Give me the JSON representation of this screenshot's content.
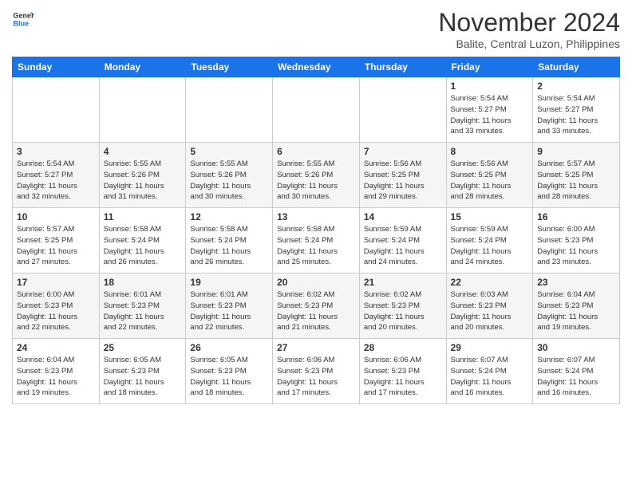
{
  "header": {
    "logo_line1": "General",
    "logo_line2": "Blue",
    "month": "November 2024",
    "location": "Balite, Central Luzon, Philippines"
  },
  "days_of_week": [
    "Sunday",
    "Monday",
    "Tuesday",
    "Wednesday",
    "Thursday",
    "Friday",
    "Saturday"
  ],
  "weeks": [
    [
      {
        "day": "",
        "info": ""
      },
      {
        "day": "",
        "info": ""
      },
      {
        "day": "",
        "info": ""
      },
      {
        "day": "",
        "info": ""
      },
      {
        "day": "",
        "info": ""
      },
      {
        "day": "1",
        "info": "Sunrise: 5:54 AM\nSunset: 5:27 PM\nDaylight: 11 hours\nand 33 minutes."
      },
      {
        "day": "2",
        "info": "Sunrise: 5:54 AM\nSunset: 5:27 PM\nDaylight: 11 hours\nand 33 minutes."
      }
    ],
    [
      {
        "day": "3",
        "info": "Sunrise: 5:54 AM\nSunset: 5:27 PM\nDaylight: 11 hours\nand 32 minutes."
      },
      {
        "day": "4",
        "info": "Sunrise: 5:55 AM\nSunset: 5:26 PM\nDaylight: 11 hours\nand 31 minutes."
      },
      {
        "day": "5",
        "info": "Sunrise: 5:55 AM\nSunset: 5:26 PM\nDaylight: 11 hours\nand 30 minutes."
      },
      {
        "day": "6",
        "info": "Sunrise: 5:55 AM\nSunset: 5:26 PM\nDaylight: 11 hours\nand 30 minutes."
      },
      {
        "day": "7",
        "info": "Sunrise: 5:56 AM\nSunset: 5:25 PM\nDaylight: 11 hours\nand 29 minutes."
      },
      {
        "day": "8",
        "info": "Sunrise: 5:56 AM\nSunset: 5:25 PM\nDaylight: 11 hours\nand 28 minutes."
      },
      {
        "day": "9",
        "info": "Sunrise: 5:57 AM\nSunset: 5:25 PM\nDaylight: 11 hours\nand 28 minutes."
      }
    ],
    [
      {
        "day": "10",
        "info": "Sunrise: 5:57 AM\nSunset: 5:25 PM\nDaylight: 11 hours\nand 27 minutes."
      },
      {
        "day": "11",
        "info": "Sunrise: 5:58 AM\nSunset: 5:24 PM\nDaylight: 11 hours\nand 26 minutes."
      },
      {
        "day": "12",
        "info": "Sunrise: 5:58 AM\nSunset: 5:24 PM\nDaylight: 11 hours\nand 26 minutes."
      },
      {
        "day": "13",
        "info": "Sunrise: 5:58 AM\nSunset: 5:24 PM\nDaylight: 11 hours\nand 25 minutes."
      },
      {
        "day": "14",
        "info": "Sunrise: 5:59 AM\nSunset: 5:24 PM\nDaylight: 11 hours\nand 24 minutes."
      },
      {
        "day": "15",
        "info": "Sunrise: 5:59 AM\nSunset: 5:24 PM\nDaylight: 11 hours\nand 24 minutes."
      },
      {
        "day": "16",
        "info": "Sunrise: 6:00 AM\nSunset: 5:23 PM\nDaylight: 11 hours\nand 23 minutes."
      }
    ],
    [
      {
        "day": "17",
        "info": "Sunrise: 6:00 AM\nSunset: 5:23 PM\nDaylight: 11 hours\nand 22 minutes."
      },
      {
        "day": "18",
        "info": "Sunrise: 6:01 AM\nSunset: 5:23 PM\nDaylight: 11 hours\nand 22 minutes."
      },
      {
        "day": "19",
        "info": "Sunrise: 6:01 AM\nSunset: 5:23 PM\nDaylight: 11 hours\nand 22 minutes."
      },
      {
        "day": "20",
        "info": "Sunrise: 6:02 AM\nSunset: 5:23 PM\nDaylight: 11 hours\nand 21 minutes."
      },
      {
        "day": "21",
        "info": "Sunrise: 6:02 AM\nSunset: 5:23 PM\nDaylight: 11 hours\nand 20 minutes."
      },
      {
        "day": "22",
        "info": "Sunrise: 6:03 AM\nSunset: 5:23 PM\nDaylight: 11 hours\nand 20 minutes."
      },
      {
        "day": "23",
        "info": "Sunrise: 6:04 AM\nSunset: 5:23 PM\nDaylight: 11 hours\nand 19 minutes."
      }
    ],
    [
      {
        "day": "24",
        "info": "Sunrise: 6:04 AM\nSunset: 5:23 PM\nDaylight: 11 hours\nand 19 minutes."
      },
      {
        "day": "25",
        "info": "Sunrise: 6:05 AM\nSunset: 5:23 PM\nDaylight: 11 hours\nand 18 minutes."
      },
      {
        "day": "26",
        "info": "Sunrise: 6:05 AM\nSunset: 5:23 PM\nDaylight: 11 hours\nand 18 minutes."
      },
      {
        "day": "27",
        "info": "Sunrise: 6:06 AM\nSunset: 5:23 PM\nDaylight: 11 hours\nand 17 minutes."
      },
      {
        "day": "28",
        "info": "Sunrise: 6:06 AM\nSunset: 5:23 PM\nDaylight: 11 hours\nand 17 minutes."
      },
      {
        "day": "29",
        "info": "Sunrise: 6:07 AM\nSunset: 5:24 PM\nDaylight: 11 hours\nand 16 minutes."
      },
      {
        "day": "30",
        "info": "Sunrise: 6:07 AM\nSunset: 5:24 PM\nDaylight: 11 hours\nand 16 minutes."
      }
    ]
  ]
}
